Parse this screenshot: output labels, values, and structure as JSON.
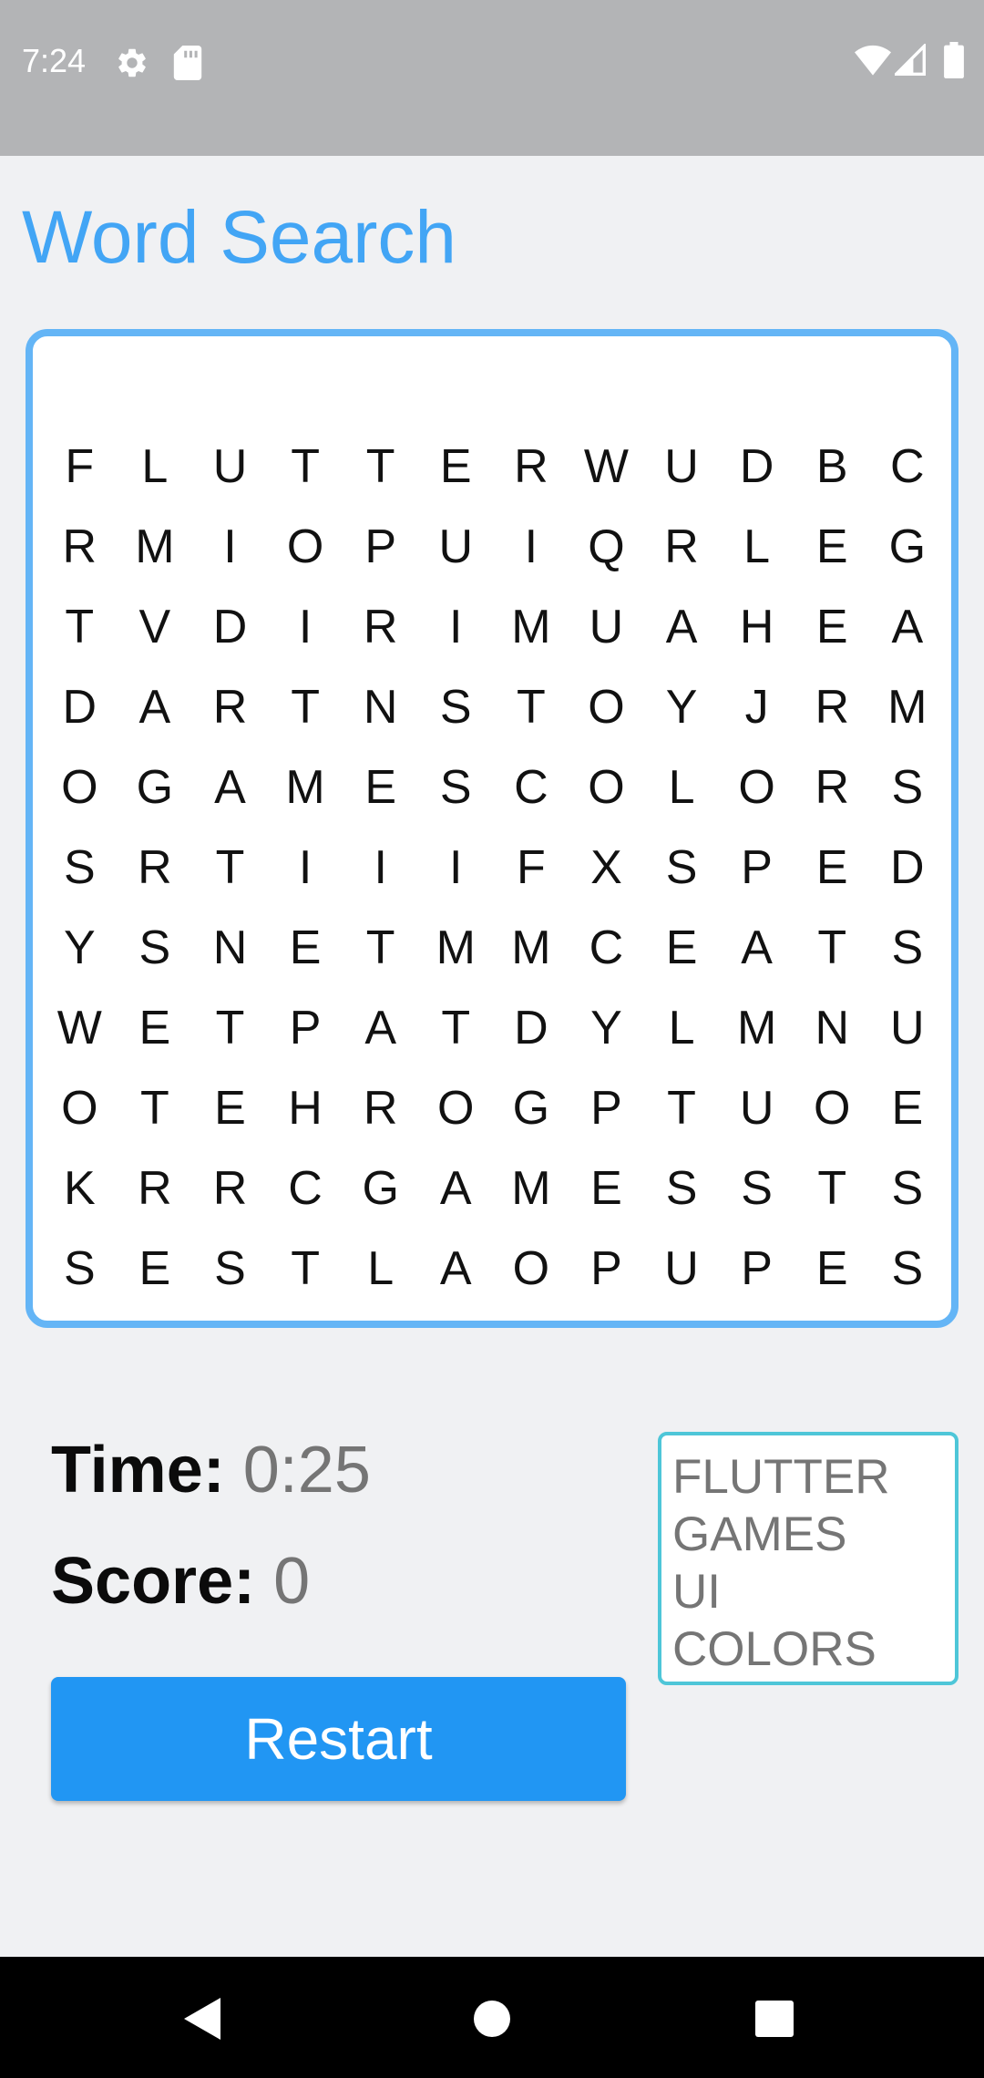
{
  "status_bar": {
    "time": "7:24",
    "left_icons": [
      "settings-icon",
      "sd-card-icon"
    ],
    "right_icons": [
      "wifi-icon",
      "signal-icon",
      "battery-icon"
    ]
  },
  "app": {
    "title": "Word Search"
  },
  "grid": {
    "rows": [
      [
        "F",
        "L",
        "U",
        "T",
        "T",
        "E",
        "R",
        "W",
        "U",
        "D",
        "B",
        "C"
      ],
      [
        "R",
        "M",
        "I",
        "O",
        "P",
        "U",
        "I",
        "Q",
        "R",
        "L",
        "E",
        "G"
      ],
      [
        "T",
        "V",
        "D",
        "I",
        "R",
        "I",
        "M",
        "U",
        "A",
        "H",
        "E",
        "A"
      ],
      [
        "D",
        "A",
        "R",
        "T",
        "N",
        "S",
        "T",
        "O",
        "Y",
        "J",
        "R",
        "M"
      ],
      [
        "O",
        "G",
        "A",
        "M",
        "E",
        "S",
        "C",
        "O",
        "L",
        "O",
        "R",
        "S"
      ],
      [
        "S",
        "R",
        "T",
        "I",
        "I",
        "I",
        "F",
        "X",
        "S",
        "P",
        "E",
        "D"
      ],
      [
        "Y",
        "S",
        "N",
        "E",
        "T",
        "M",
        "M",
        "C",
        "E",
        "A",
        "T",
        "S"
      ],
      [
        "W",
        "E",
        "T",
        "P",
        "A",
        "T",
        "D",
        "Y",
        "L",
        "M",
        "N",
        "U"
      ],
      [
        "O",
        "T",
        "E",
        "H",
        "R",
        "O",
        "G",
        "P",
        "T",
        "U",
        "O",
        "E"
      ],
      [
        "K",
        "R",
        "R",
        "C",
        "G",
        "A",
        "M",
        "E",
        "S",
        "S",
        "T",
        "S"
      ],
      [
        "S",
        "E",
        "S",
        "T",
        "L",
        "A",
        "O",
        "P",
        "U",
        "P",
        "E",
        "S"
      ]
    ]
  },
  "stats": {
    "time_label": "Time:",
    "time_value": "0:25",
    "score_label": "Score:",
    "score_value": "0"
  },
  "actions": {
    "restart_label": "Restart"
  },
  "words": [
    "FLUTTER",
    "GAMES",
    "UI",
    "COLORS"
  ],
  "navigation": {
    "buttons": [
      "back-icon",
      "home-icon",
      "recents-icon"
    ]
  },
  "colors": {
    "accent": "#42a5f5",
    "grid_border": "#64b5f6",
    "button": "#2196f3",
    "word_list_border": "#4ec6d8"
  }
}
